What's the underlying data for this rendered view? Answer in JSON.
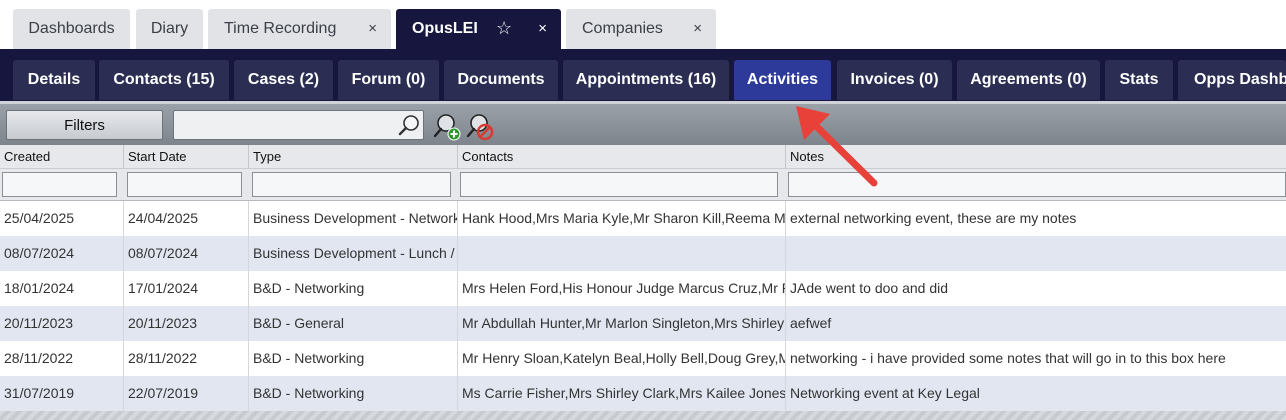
{
  "top_tabs": [
    {
      "label": "Dashboards"
    },
    {
      "label": "Diary"
    },
    {
      "label": "Time Recording",
      "close": "×"
    },
    {
      "label": "OpusLEI",
      "star": "☆",
      "close": "×"
    },
    {
      "label": "Companies",
      "close": "×"
    }
  ],
  "sub_tabs": [
    {
      "label": "Details"
    },
    {
      "label": "Contacts (15)"
    },
    {
      "label": "Cases (2)"
    },
    {
      "label": "Forum (0)"
    },
    {
      "label": "Documents"
    },
    {
      "label": "Appointments (16)"
    },
    {
      "label": "Activities"
    },
    {
      "label": "Invoices (0)"
    },
    {
      "label": "Agreements (0)"
    },
    {
      "label": "Stats"
    },
    {
      "label": "Opps Dashbo"
    }
  ],
  "toolbar": {
    "filters_label": "Filters",
    "search_value": "",
    "icons": [
      "search-icon",
      "add-filter-icon",
      "clear-filter-icon"
    ]
  },
  "grid": {
    "columns": [
      "Created",
      "Start Date",
      "Type",
      "Contacts",
      "Notes"
    ],
    "rows": [
      [
        "25/04/2025",
        "24/04/2025",
        "Business Development - Networking",
        "Hank Hood,Mrs Maria Kyle,Mr Sharon Kill,Reema Ma",
        "external networking event, these are my notes"
      ],
      [
        "08/07/2024",
        "08/07/2024",
        "Business Development - Lunch /",
        "",
        ""
      ],
      [
        "18/01/2024",
        "17/01/2024",
        "B&D - Networking",
        "Mrs Helen Ford,His Honour Judge Marcus Cruz,Mr R",
        "JAde went to doo and did"
      ],
      [
        "20/11/2023",
        "20/11/2023",
        "B&D - General",
        "Mr Abdullah Hunter,Mr Marlon Singleton,Mrs Shirley",
        "aefwef"
      ],
      [
        "28/11/2022",
        "28/11/2022",
        "B&D - Networking",
        "Mr Henry Sloan,Katelyn Beal,Holly Bell,Doug Grey,M",
        "networking - i have provided some notes that will go in to this box here"
      ],
      [
        "31/07/2019",
        "22/07/2019",
        "B&D - Networking",
        "Ms Carrie Fisher,Mrs Shirley Clark,Mrs Kailee Jones,",
        "Networking event at Key Legal"
      ]
    ]
  },
  "colors": {
    "nav_dark": "#16163f",
    "tab_active": "#2e3a9a",
    "row_alt": "#e1e6f1",
    "arrow": "#e8413a"
  }
}
